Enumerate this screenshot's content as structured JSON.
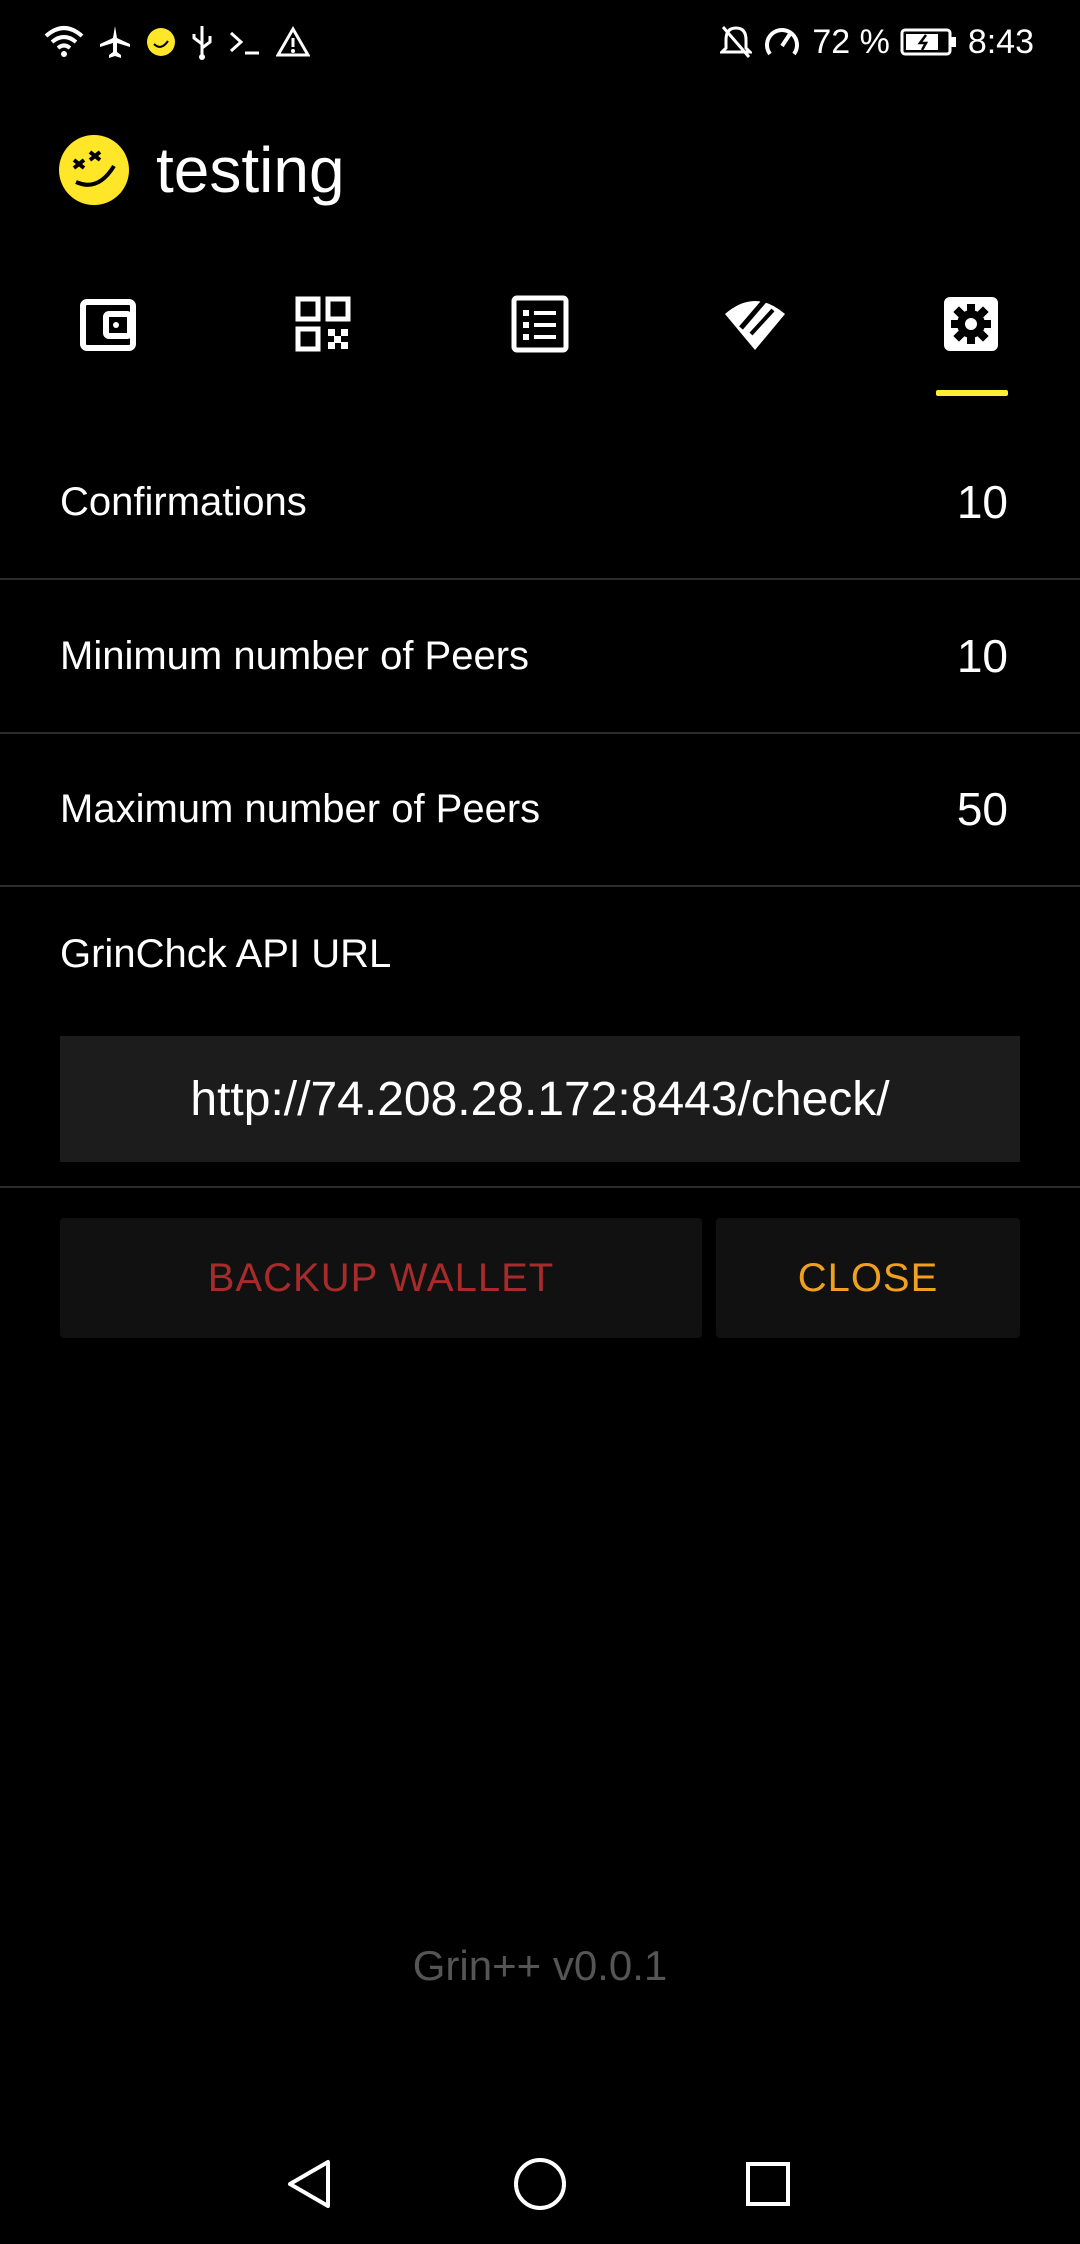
{
  "status_bar": {
    "left_icons": [
      "wifi-icon",
      "airplane-icon",
      "grin-notification-icon",
      "usb-icon",
      "terminal-icon",
      "warning-icon"
    ],
    "right_icons": [
      "notifications-muted-icon",
      "data-saver-icon",
      "battery-charging-icon"
    ],
    "battery": "72 %",
    "time": "8:43"
  },
  "header": {
    "wallet_name": "testing",
    "logo_color": "#ffe629"
  },
  "tabs": [
    {
      "name": "wallet",
      "icon": "wallet-icon"
    },
    {
      "name": "receive",
      "icon": "qr-code-icon"
    },
    {
      "name": "transactions",
      "icon": "list-icon"
    },
    {
      "name": "network",
      "icon": "wifi-status-icon"
    },
    {
      "name": "settings",
      "icon": "gear-icon",
      "active": true
    }
  ],
  "settings": {
    "confirmations_label": "Confirmations",
    "confirmations_value": "10",
    "min_peers_label": "Minimum number of Peers",
    "min_peers_value": "10",
    "max_peers_label": "Maximum number of Peers",
    "max_peers_value": "50",
    "api_url_label": "GrinChck API URL",
    "api_url_value": "http://74.208.28.172:8443/check/"
  },
  "buttons": {
    "backup_label": "BACKUP WALLET",
    "close_label": "CLOSE"
  },
  "footer": {
    "version": "Grin++ v0.0.1"
  },
  "colors": {
    "accent_tab": "#ffee33",
    "backup_text": "#a72b2b",
    "close_text": "#f0a020"
  }
}
